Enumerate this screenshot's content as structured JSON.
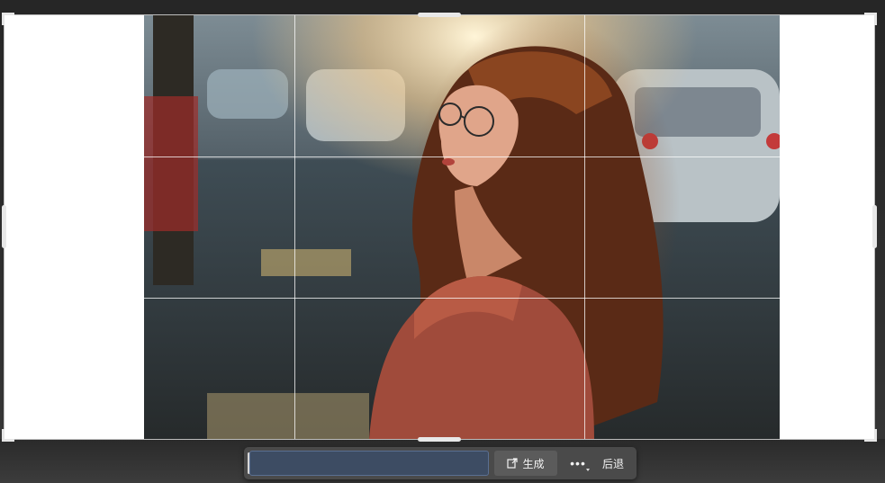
{
  "canvas": {
    "background": "#ffffff",
    "photo_description_icon": "portrait-photo"
  },
  "toolbar": {
    "prompt_value": "",
    "prompt_placeholder": "",
    "generate_icon": "generate-icon",
    "generate_label": "生成",
    "more_label": "•••",
    "back_label": "后退"
  },
  "colors": {
    "toolbar_bg": "#4a4a4a",
    "input_bg": "#3d4c63",
    "input_border": "#5a6f92",
    "grid_line": "#ffffff"
  }
}
